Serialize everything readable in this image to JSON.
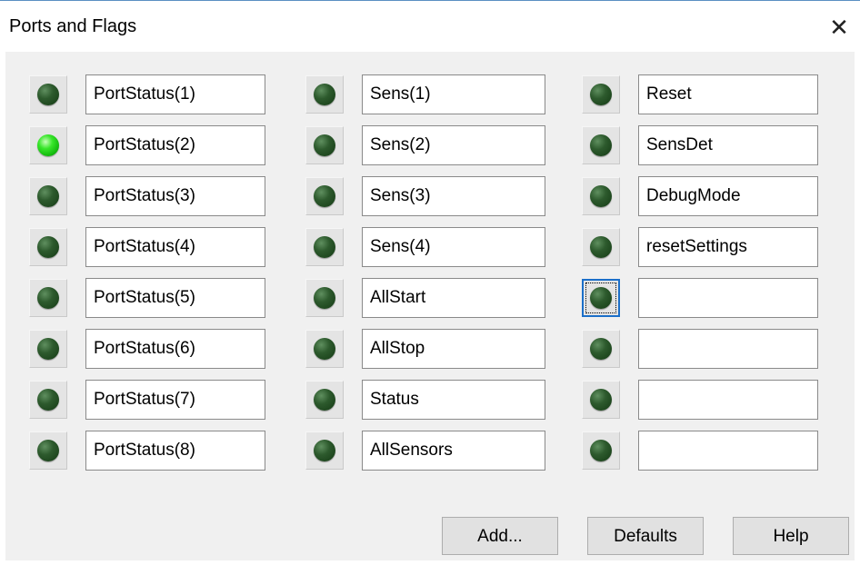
{
  "window": {
    "title": "Ports and Flags",
    "close_glyph": "✕"
  },
  "columns": [
    {
      "rows": [
        {
          "label": "PortStatus(1)",
          "led": "off"
        },
        {
          "label": "PortStatus(2)",
          "led": "on"
        },
        {
          "label": "PortStatus(3)",
          "led": "off"
        },
        {
          "label": "PortStatus(4)",
          "led": "off"
        },
        {
          "label": "PortStatus(5)",
          "led": "off"
        },
        {
          "label": "PortStatus(6)",
          "led": "off"
        },
        {
          "label": "PortStatus(7)",
          "led": "off"
        },
        {
          "label": "PortStatus(8)",
          "led": "off"
        }
      ]
    },
    {
      "rows": [
        {
          "label": "Sens(1)",
          "led": "off"
        },
        {
          "label": "Sens(2)",
          "led": "off"
        },
        {
          "label": "Sens(3)",
          "led": "off"
        },
        {
          "label": "Sens(4)",
          "led": "off"
        },
        {
          "label": "AllStart",
          "led": "off"
        },
        {
          "label": "AllStop",
          "led": "off"
        },
        {
          "label": "Status",
          "led": "off"
        },
        {
          "label": "AllSensors",
          "led": "off"
        }
      ]
    },
    {
      "rows": [
        {
          "label": "Reset",
          "led": "off"
        },
        {
          "label": "SensDet",
          "led": "off"
        },
        {
          "label": "DebugMode",
          "led": "off"
        },
        {
          "label": "resetSettings",
          "led": "off"
        },
        {
          "label": "",
          "led": "off",
          "focused": true
        },
        {
          "label": "",
          "led": "off"
        },
        {
          "label": "",
          "led": "off"
        },
        {
          "label": "",
          "led": "off"
        }
      ]
    }
  ],
  "buttons": {
    "add": "Add...",
    "defaults": "Defaults",
    "help": "Help"
  },
  "colors": {
    "led_on": "#22d21a",
    "led_off": "#2d5a2d",
    "focus": "#1c6fc9"
  }
}
